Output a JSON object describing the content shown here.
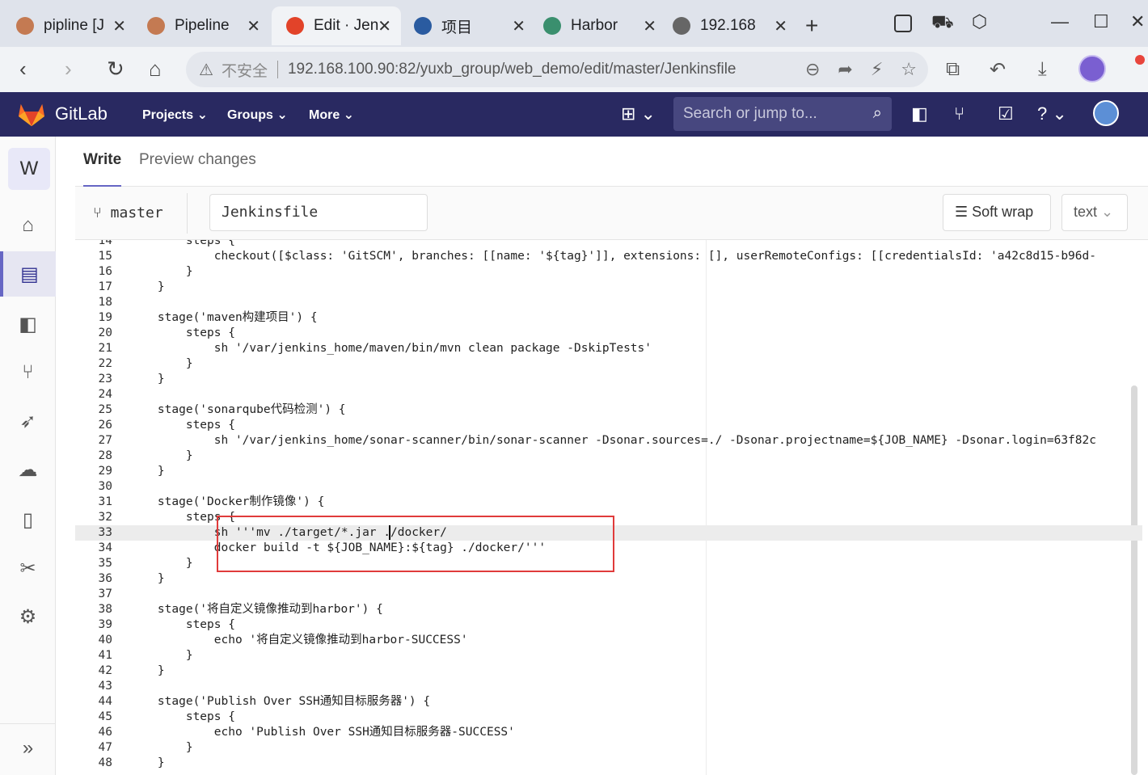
{
  "browser": {
    "tabs": [
      {
        "label": "pipline [J",
        "color": "#c47a52"
      },
      {
        "label": "Pipeline",
        "color": "#c47a52"
      },
      {
        "label": "Edit · Jen",
        "color": "#e24329"
      },
      {
        "label": "项目",
        "color": "#2a5ba0"
      },
      {
        "label": "Harbor",
        "color": "#3a8f6e"
      },
      {
        "label": "192.168.",
        "color": "#666666"
      }
    ],
    "insecure_label": "不安全",
    "url": "192.168.100.90:82/yuxb_group/web_demo/edit/master/Jenkinsfile"
  },
  "gitlab": {
    "brand": "GitLab",
    "menu": [
      "Projects",
      "Groups",
      "More"
    ],
    "search_placeholder": "Search or jump to...",
    "project_initial": "W"
  },
  "editor": {
    "tabs": {
      "write": "Write",
      "preview": "Preview changes"
    },
    "branch": "master",
    "filename": "Jenkinsfile",
    "soft_wrap": "Soft wrap",
    "mode": "text",
    "lines": [
      {
        "n": "14",
        "t": "        steps {"
      },
      {
        "n": "15",
        "t": "            checkout([$class: 'GitSCM', branches: [[name: '${tag}']], extensions: [], userRemoteConfigs: [[credentialsId: 'a42c8d15-b96d-"
      },
      {
        "n": "16",
        "t": "        }"
      },
      {
        "n": "17",
        "t": "    }"
      },
      {
        "n": "18",
        "t": ""
      },
      {
        "n": "19",
        "t": "    stage('maven构建项目') {"
      },
      {
        "n": "20",
        "t": "        steps {"
      },
      {
        "n": "21",
        "t": "            sh '/var/jenkins_home/maven/bin/mvn clean package -DskipTests'"
      },
      {
        "n": "22",
        "t": "        }"
      },
      {
        "n": "23",
        "t": "    }"
      },
      {
        "n": "24",
        "t": ""
      },
      {
        "n": "25",
        "t": "    stage('sonarqube代码检测') {"
      },
      {
        "n": "26",
        "t": "        steps {"
      },
      {
        "n": "27",
        "t": "            sh '/var/jenkins_home/sonar-scanner/bin/sonar-scanner -Dsonar.sources=./ -Dsonar.projectname=${JOB_NAME} -Dsonar.login=63f82c"
      },
      {
        "n": "28",
        "t": "        }"
      },
      {
        "n": "29",
        "t": "    }"
      },
      {
        "n": "30",
        "t": ""
      },
      {
        "n": "31",
        "t": "    stage('Docker制作镜像') {"
      },
      {
        "n": "32",
        "t": "        steps {"
      },
      {
        "n": "33",
        "t": "            sh '''mv ./target/*.jar ./docker/"
      },
      {
        "n": "34",
        "t": "            docker build -t ${JOB_NAME}:${tag} ./docker/'''"
      },
      {
        "n": "35",
        "t": "        }"
      },
      {
        "n": "36",
        "t": "    }"
      },
      {
        "n": "37",
        "t": ""
      },
      {
        "n": "38",
        "t": "    stage('将自定义镜像推动到harbor') {"
      },
      {
        "n": "39",
        "t": "        steps {"
      },
      {
        "n": "40",
        "t": "            echo '将自定义镜像推动到harbor-SUCCESS'"
      },
      {
        "n": "41",
        "t": "        }"
      },
      {
        "n": "42",
        "t": "    }"
      },
      {
        "n": "43",
        "t": ""
      },
      {
        "n": "44",
        "t": "    stage('Publish Over SSH通知目标服务器') {"
      },
      {
        "n": "45",
        "t": "        steps {"
      },
      {
        "n": "46",
        "t": "            echo 'Publish Over SSH通知目标服务器-SUCCESS'"
      },
      {
        "n": "47",
        "t": "        }"
      },
      {
        "n": "48",
        "t": "    }"
      }
    ]
  }
}
